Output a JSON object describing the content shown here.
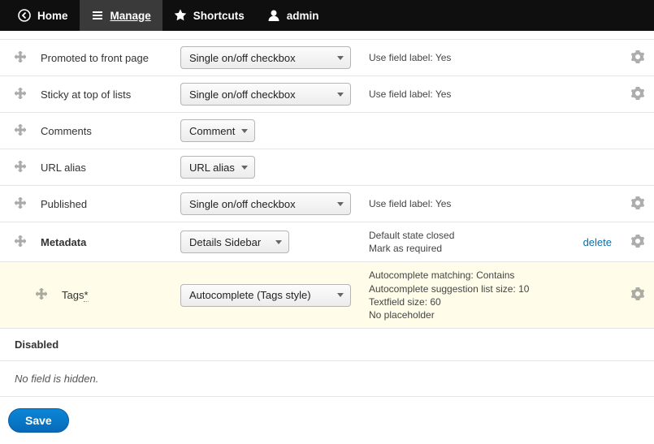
{
  "toolbar": {
    "home": "Home",
    "manage": "Manage",
    "shortcuts": "Shortcuts",
    "admin": "admin"
  },
  "rows": {
    "promoted": {
      "label": "Promoted to front page",
      "widget": "Single on/off checkbox",
      "summary": "Use field label: Yes"
    },
    "sticky": {
      "label": "Sticky at top of lists",
      "widget": "Single on/off checkbox",
      "summary": "Use field label: Yes"
    },
    "comments": {
      "label": "Comments",
      "widget": "Comment"
    },
    "url_alias": {
      "label": "URL alias",
      "widget": "URL alias"
    },
    "published": {
      "label": "Published",
      "widget": "Single on/off checkbox",
      "summary": "Use field label: Yes"
    },
    "metadata": {
      "label": "Metadata",
      "widget": "Details Sidebar",
      "summary_line1": "Default state closed",
      "summary_line2": "Mark as required",
      "link": "delete"
    },
    "tags": {
      "label": "Tags",
      "asterisk": "*",
      "widget": "Autocomplete (Tags style)",
      "summary_line1": "Autocomplete matching: Contains",
      "summary_line2": "Autocomplete suggestion list size: 10",
      "summary_line3": "Textfield size: 60",
      "summary_line4": "No placeholder"
    }
  },
  "disabled": {
    "heading": "Disabled",
    "message": "No field is hidden."
  },
  "actions": {
    "save": "Save"
  }
}
